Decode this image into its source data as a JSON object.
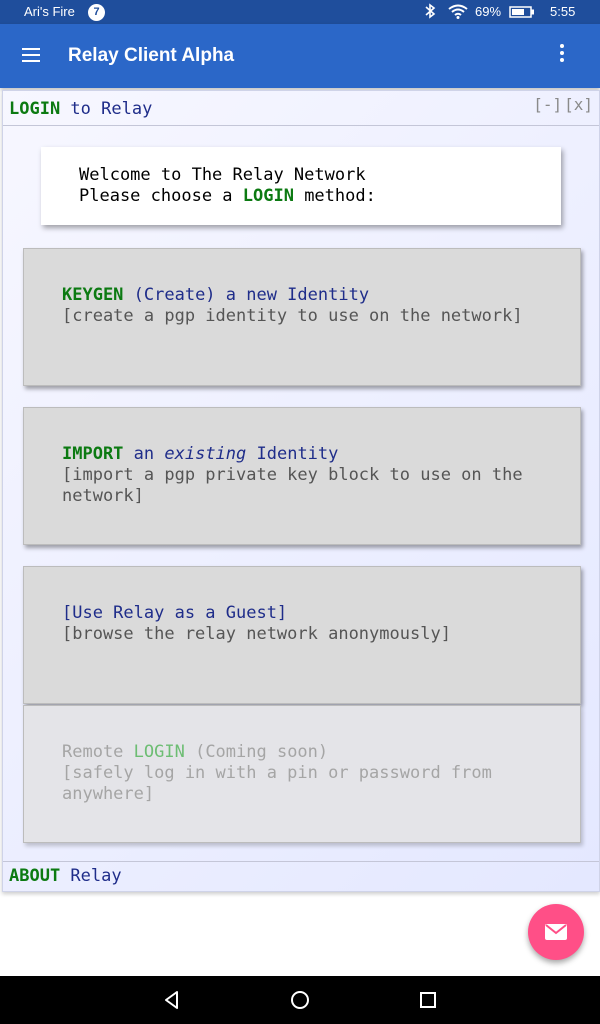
{
  "status_bar": {
    "carrier": "Ari's Fire",
    "notification_count": "7",
    "battery_percent": "69%",
    "time": "5:55",
    "icons": [
      "bluetooth-icon",
      "wifi-icon",
      "battery-icon"
    ]
  },
  "app_bar": {
    "title": "Relay Client Alpha",
    "menu_icon": "hamburger-menu-icon",
    "overflow_icon": "more-vert-icon"
  },
  "panel": {
    "header_keyword": "LOGIN",
    "header_rest": " to Relay",
    "minimize_label": "[-]",
    "close_label": "[x]",
    "welcome_line1": "Welcome to The Relay Network",
    "welcome_line2_pre": "Please choose a ",
    "welcome_line2_keyword": "LOGIN",
    "welcome_line2_post": " method:",
    "options": [
      {
        "keyword": "KEYGEN",
        "main_rest": " (Create) a new Identity",
        "sub": "[create a pgp identity to use on the network]"
      },
      {
        "keyword": "IMPORT",
        "main_mid": " an ",
        "main_em": "existing",
        "main_rest": " Identity",
        "sub": "[import a pgp private key block to use on the network]"
      },
      {
        "main": "[Use Relay as a Guest]",
        "sub": "[browse the relay network anonymously]"
      },
      {
        "main_pre": "Remote ",
        "keyword": "LOGIN",
        "main_rest": " (Coming soon)",
        "sub": "[safely log in with a pin or password from anywhere]",
        "disabled": true
      }
    ],
    "footer_keyword": "ABOUT",
    "footer_rest": " Relay"
  },
  "fab": {
    "icon": "mail-icon"
  },
  "nav_bar": {
    "icons": [
      "back-icon",
      "home-icon",
      "recents-icon"
    ]
  },
  "colors": {
    "status_bar": "#1f4e9c",
    "app_bar": "#2b67c8",
    "keyword_green": "#0c7a12",
    "text_blue": "#1f2d8a",
    "fab_pink": "#ff4f87"
  }
}
